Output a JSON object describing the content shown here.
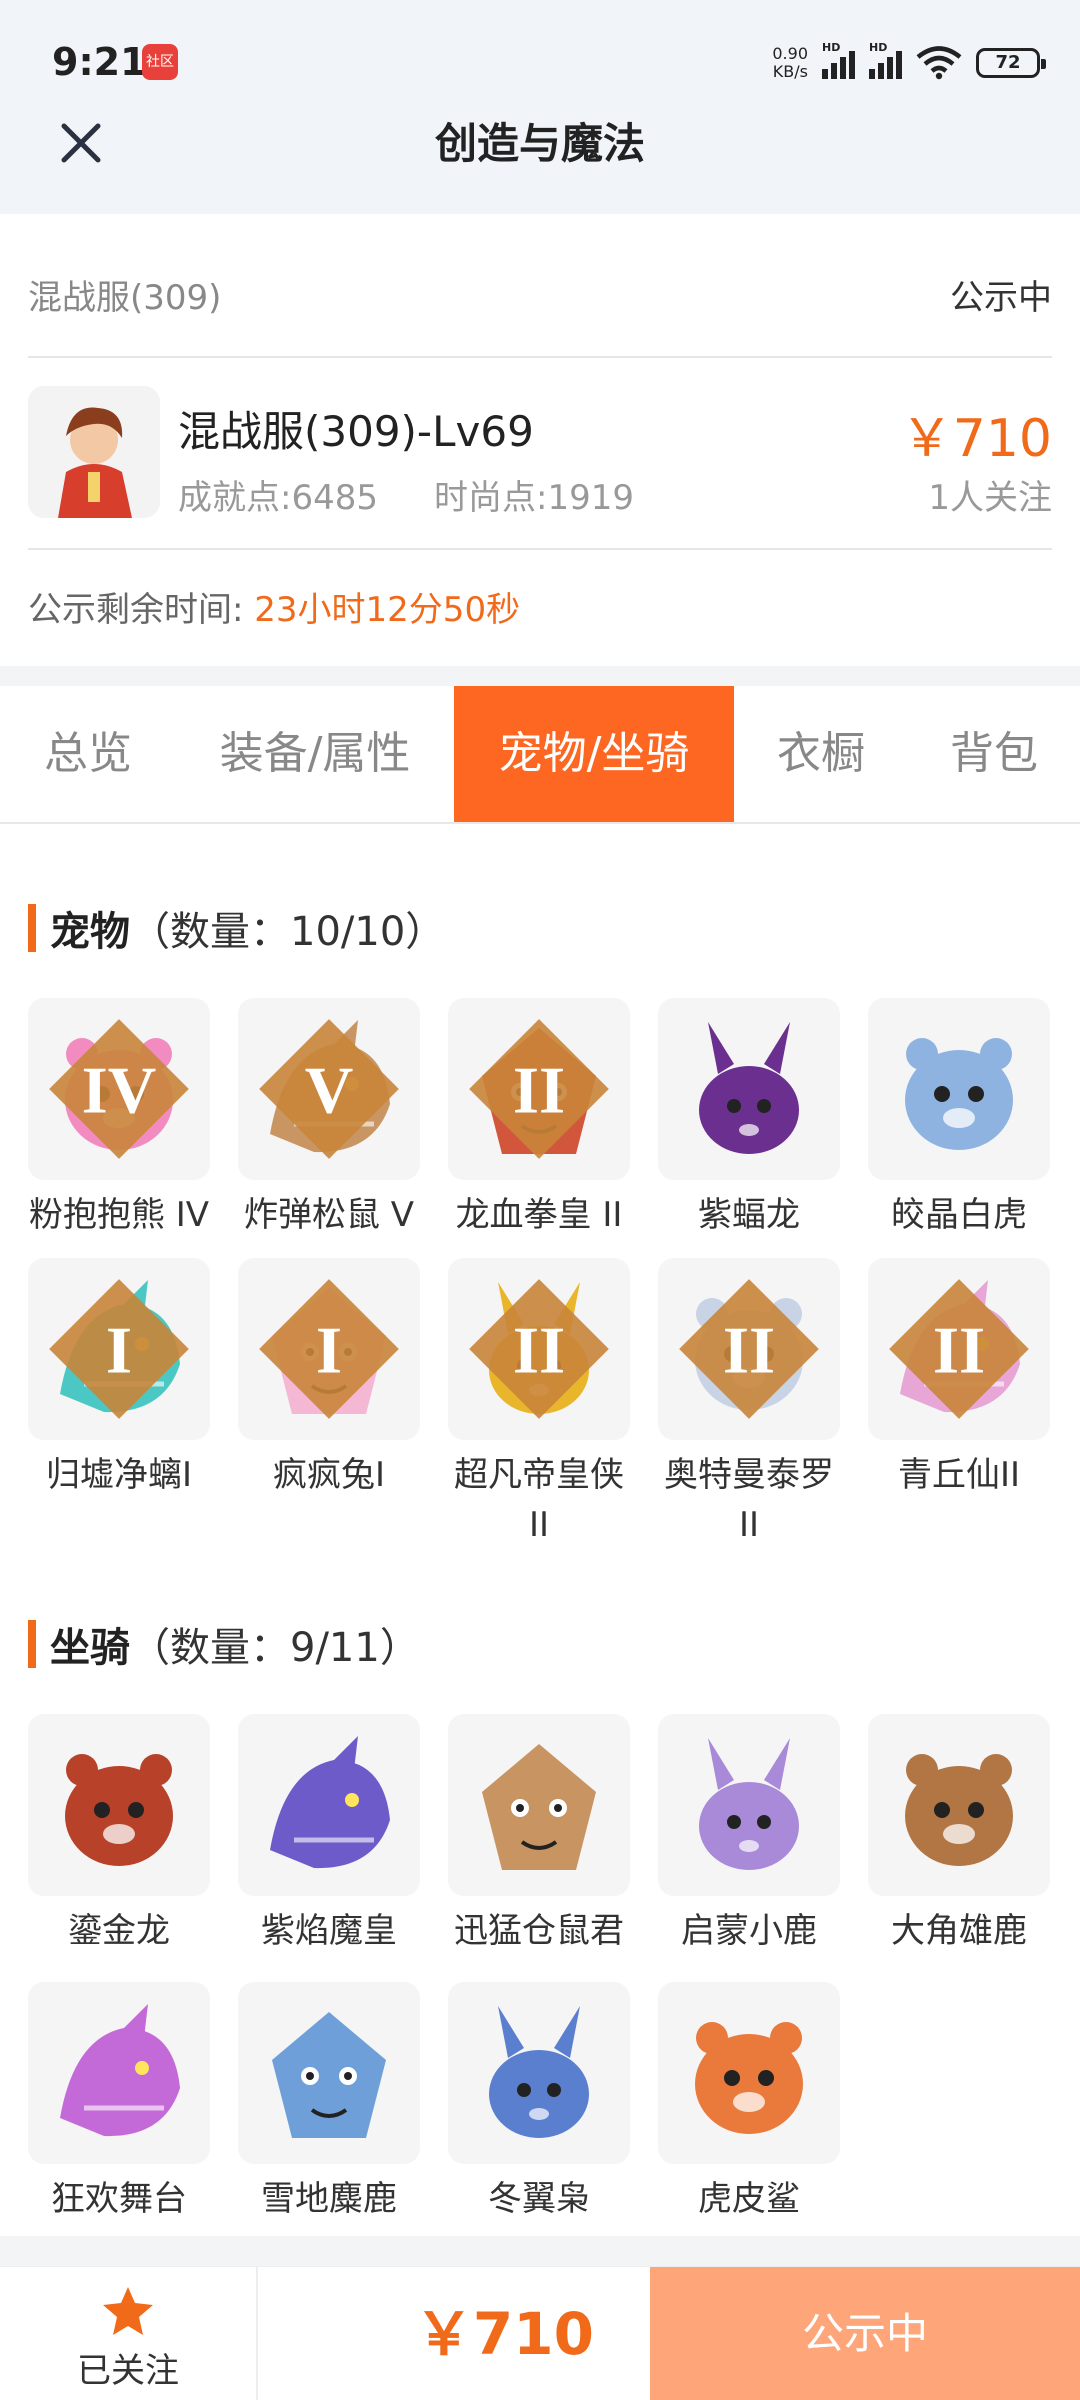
{
  "status_bar": {
    "time": "9:21",
    "app_badge": "社区",
    "net_speed_value": "0.90",
    "net_speed_unit": "KB/s",
    "signal_label": "HD",
    "battery": "72"
  },
  "header": {
    "title": "创造与魔法",
    "close_icon": "close-icon"
  },
  "listing": {
    "server": "混战服(309)",
    "status": "公示中",
    "role_name": "混战服(309)-Lv69",
    "achievement": "成就点:6485",
    "fashion": "时尚点:1919",
    "price": "￥710",
    "followers": "1人关注",
    "timer_label": "公示剩余时间:",
    "timer_value": "23小时12分50秒"
  },
  "tabs": [
    {
      "label": "总览",
      "active": false
    },
    {
      "label": "装备/属性",
      "active": false
    },
    {
      "label": "宠物/坐骑",
      "active": true
    },
    {
      "label": "衣橱",
      "active": false
    },
    {
      "label": "背包",
      "active": false
    }
  ],
  "pets": {
    "title": "宠物",
    "count": "（数量：10/10）",
    "items": [
      {
        "name": "粉抱抱熊 IV",
        "badge": "IV",
        "color": "#f28cc0"
      },
      {
        "name": "炸弹松鼠 V",
        "badge": "V",
        "color": "#c99563"
      },
      {
        "name": "龙血拳皇 II",
        "badge": "II",
        "color": "#d2563b"
      },
      {
        "name": "紫蝠龙",
        "badge": "",
        "color": "#6b2f8f"
      },
      {
        "name": "皎晶白虎",
        "badge": "",
        "color": "#8fb3e0"
      },
      {
        "name": "归墟净螭I",
        "badge": "I",
        "color": "#4cc8c4"
      },
      {
        "name": "疯疯兔I",
        "badge": "I",
        "color": "#f4b7d4"
      },
      {
        "name": "超凡帝皇侠II",
        "badge": "II",
        "color": "#e9b52a"
      },
      {
        "name": "奥特曼泰罗II",
        "badge": "II",
        "color": "#c9d3e6"
      },
      {
        "name": "青丘仙II",
        "badge": "II",
        "color": "#e7a6d6"
      }
    ]
  },
  "mounts": {
    "title": "坐骑",
    "count": "（数量：9/11）",
    "items": [
      {
        "name": "鎏金龙",
        "color": "#b8412a"
      },
      {
        "name": "紫焰魔皇",
        "color": "#6d5bc9"
      },
      {
        "name": "迅猛仓鼠君",
        "color": "#c89462"
      },
      {
        "name": "启蒙小鹿",
        "color": "#a98ad8"
      },
      {
        "name": "大角雄鹿",
        "color": "#b27644"
      },
      {
        "name": "狂欢舞台",
        "color": "#c46ad8"
      },
      {
        "name": "雪地麋鹿",
        "color": "#6f9fd8"
      },
      {
        "name": "冬翼枭",
        "color": "#5a7fcf"
      },
      {
        "name": "虎皮鲨",
        "color": "#ea7a3b"
      }
    ]
  },
  "bottom": {
    "follow_label": "已关注",
    "price": "￥710",
    "action_label": "公示中"
  },
  "colors": {
    "accent": "#f06a1a",
    "tab_active": "#fd6722",
    "action_bg": "#fea57a"
  }
}
